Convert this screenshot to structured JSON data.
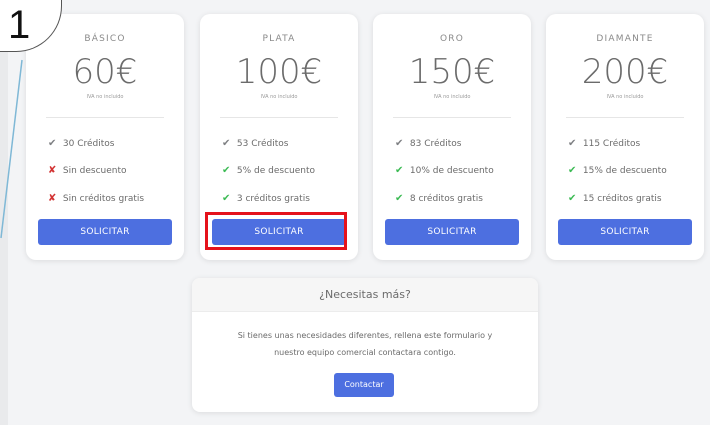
{
  "annotation": {
    "step_number": "1"
  },
  "plans": [
    {
      "name": "BÁSICO",
      "price": "60€",
      "vat_note": "IVA no incluido",
      "features": [
        {
          "icon": "check-icon",
          "text": "30 Créditos"
        },
        {
          "icon": "cross-icon",
          "text": "Sin descuento"
        },
        {
          "icon": "cross-icon",
          "text": "Sin créditos gratis"
        }
      ],
      "button_label": "SOLICITAR"
    },
    {
      "name": "PLATA",
      "price": "100€",
      "vat_note": "IVA no incluido",
      "features": [
        {
          "icon": "check-icon",
          "text": "53 Créditos"
        },
        {
          "icon": "check-icon",
          "text": "5% de descuento"
        },
        {
          "icon": "check-icon",
          "text": "3 créditos gratis"
        }
      ],
      "button_label": "SOLICITAR"
    },
    {
      "name": "ORO",
      "price": "150€",
      "vat_note": "IVA no incluido",
      "features": [
        {
          "icon": "check-icon",
          "text": "83 Créditos"
        },
        {
          "icon": "check-icon",
          "text": "10% de descuento"
        },
        {
          "icon": "check-icon",
          "text": "8 créditos gratis"
        }
      ],
      "button_label": "SOLICITAR"
    },
    {
      "name": "DIAMANTE",
      "price": "200€",
      "vat_note": "IVA no incluido",
      "features": [
        {
          "icon": "check-icon",
          "text": "115 Créditos"
        },
        {
          "icon": "check-icon",
          "text": "15% de descuento"
        },
        {
          "icon": "check-icon",
          "text": "15 créditos gratis"
        }
      ],
      "button_label": "SOLICITAR"
    }
  ],
  "more": {
    "title": "¿Necesitas más?",
    "description_line1": "Si tienes unas necesidades diferentes, rellena este formulario y",
    "description_line2": "nuestro equipo comercial contactara contigo.",
    "button_label": "Contactar"
  },
  "colors": {
    "accent": "#4d6fe0",
    "check_green": "#3dbb55",
    "cross_red": "#d23232",
    "highlight_red": "#e5121b"
  }
}
